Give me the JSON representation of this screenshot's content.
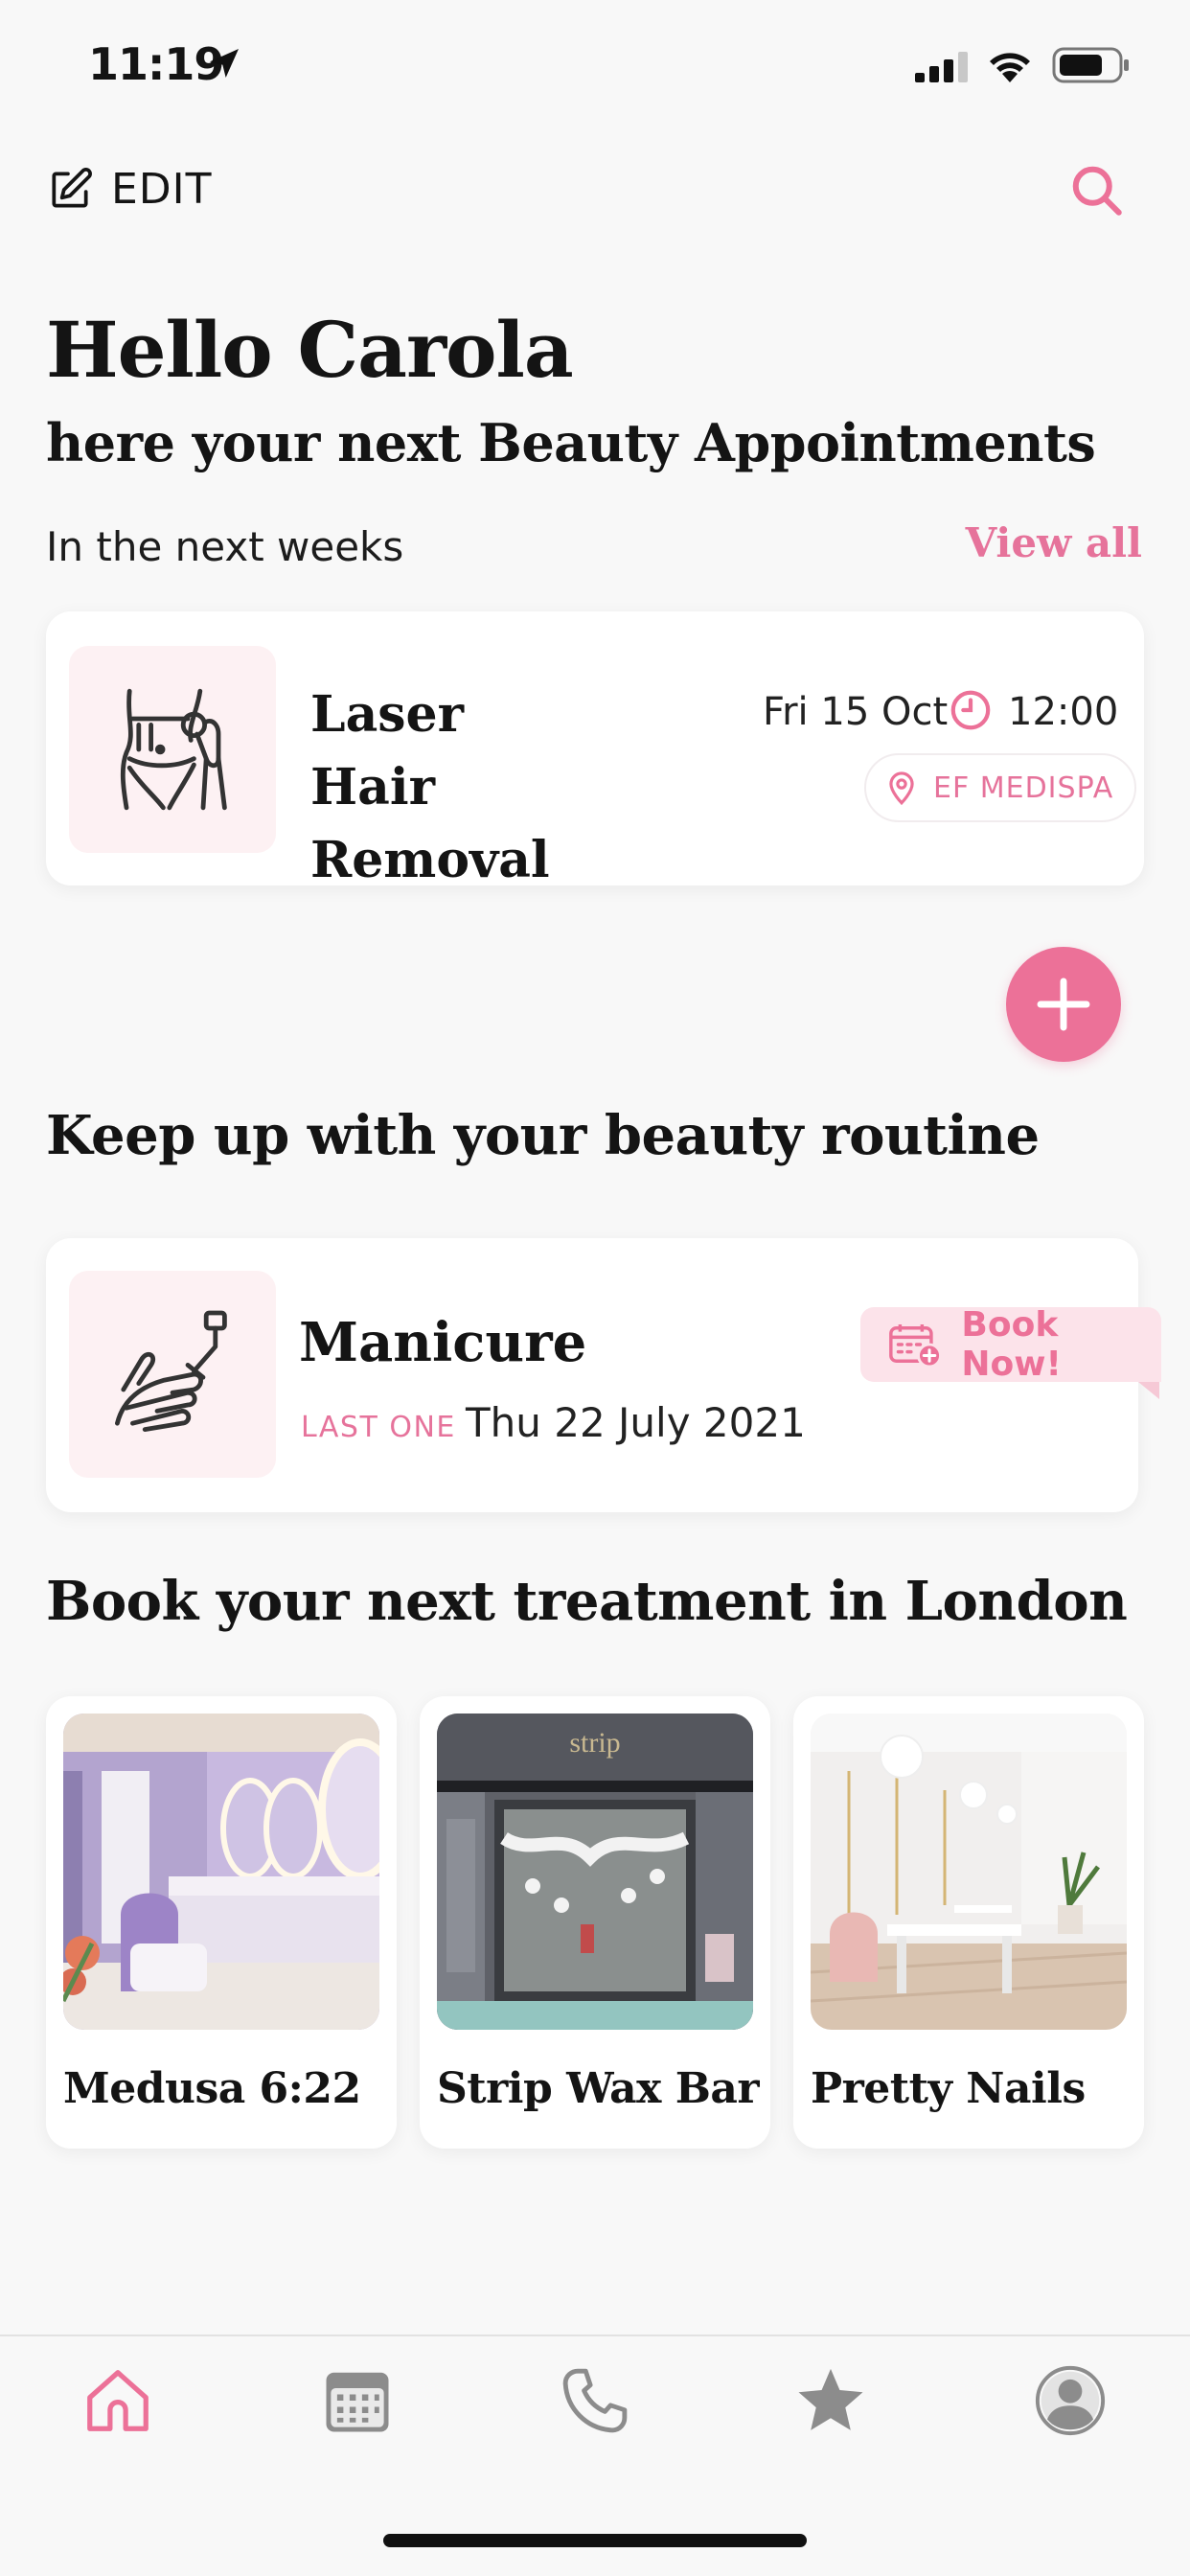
{
  "status_bar": {
    "time": "11:19"
  },
  "top_bar": {
    "edit_label": "EDIT"
  },
  "greeting": {
    "title": "Hello Carola",
    "subtitle": "here your next Beauty Appointments",
    "period_label": "In the next weeks",
    "view_all": "View all"
  },
  "appointment": {
    "title": "Laser Hair Removal",
    "date": "Fri 15 Oct",
    "time": "12:00",
    "location": "EF MEDISPA"
  },
  "routine": {
    "section_title": "Keep up with your beauty routine",
    "treatment": "Manicure",
    "last_label": "LAST ONE",
    "last_date": "Thu 22 July 2021",
    "book_now": "Book Now!"
  },
  "venues": {
    "section_title": "Book your next treatment in London",
    "items": [
      {
        "name": "Medusa 6:22"
      },
      {
        "name": "Strip Wax Bar",
        "sign": "strip"
      },
      {
        "name": "Pretty Nails"
      }
    ]
  },
  "tab_bar": {
    "items": [
      {
        "icon": "home-icon",
        "active": true
      },
      {
        "icon": "calendar-icon",
        "active": false
      },
      {
        "icon": "phone-icon",
        "active": false
      },
      {
        "icon": "star-icon",
        "active": false
      },
      {
        "icon": "profile-icon",
        "active": false
      }
    ]
  },
  "colors": {
    "accent": "#ec7198",
    "accent_light": "#fce3ea",
    "thumb_bg": "#fdf1f3",
    "background": "#f8f8f8"
  }
}
